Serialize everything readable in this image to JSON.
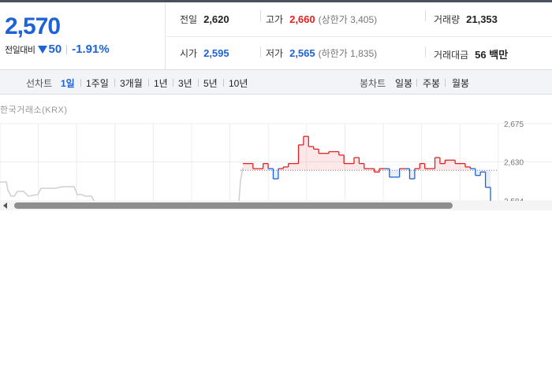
{
  "quote": {
    "price": "2,570",
    "change_label": "전일대비",
    "change_value": "50",
    "change_rate": "-1.91%",
    "color_down": "#1e63d6",
    "color_up": "#e22020"
  },
  "stats": {
    "prev_close_label": "전일",
    "prev_close": "2,620",
    "high_label": "고가",
    "high": "2,660",
    "upper_limit": "(상한가 3,405)",
    "volume_label": "거래량",
    "volume": "21,353",
    "open_label": "시가",
    "open": "2,595",
    "low_label": "저가",
    "low": "2,565",
    "lower_limit": "(하한가 1,835)",
    "amount_label": "거래대금",
    "amount": "56 백만"
  },
  "tabs": {
    "line_chart_label": "선차트",
    "periods": [
      "1일",
      "1주일",
      "3개월",
      "1년",
      "3년",
      "5년",
      "10년"
    ],
    "active_period": "1일",
    "candle_chart_label": "봉차트",
    "candles": [
      "일봉",
      "주봉",
      "월봉"
    ]
  },
  "chart": {
    "source": "한국거래소(KRX)",
    "ticks": [
      "2,675",
      "2,630",
      "2,584"
    ]
  },
  "chart_data": {
    "type": "line",
    "title": "",
    "xlabel": "",
    "ylabel": "",
    "ylim": [
      2584,
      2675
    ],
    "yticks": [
      2675,
      2630,
      2584
    ],
    "baseline": 2620,
    "series": [
      {
        "values": [
          2628,
          2628,
          2622,
          2622,
          2628,
          2622,
          2610,
          2622,
          2624,
          2628,
          2628,
          2650,
          2660,
          2648,
          2645,
          2640,
          2640,
          2642,
          2642,
          2638,
          2628,
          2628,
          2635,
          2628,
          2622,
          2622,
          2618,
          2622,
          2622,
          2612,
          2612,
          2622,
          2622,
          2610,
          2622,
          2628,
          2622,
          2622,
          2635,
          2628,
          2632,
          2632,
          2628,
          2628,
          2624,
          2622,
          2614,
          2618,
          2600,
          2580
        ]
      }
    ]
  },
  "scrollbar": {
    "position": 0.03,
    "extent": 0.79
  }
}
